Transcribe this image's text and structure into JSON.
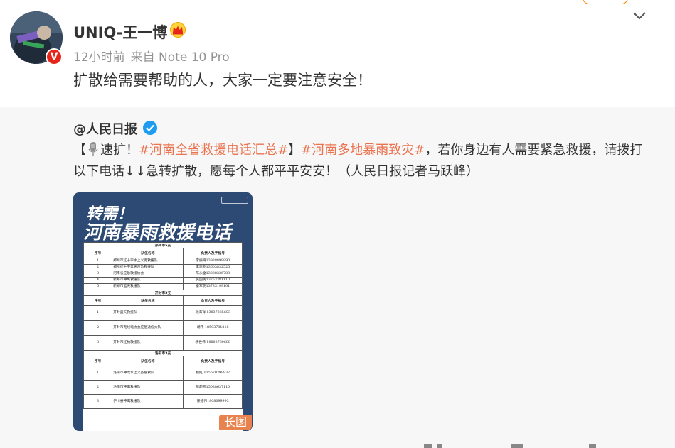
{
  "post": {
    "username": "UNIQ-王一博",
    "time": "12小时前",
    "source": "来自 Note 10 Pro",
    "text": "扩散给需要帮助的人，大家一定要注意安全！",
    "avatar_badge": "V"
  },
  "repost": {
    "author": "@人民日报",
    "line1_prefix": "【",
    "line1_speed": "速扩！",
    "tag1": "#河南全省救援电话汇总#",
    "line1_mid": "】",
    "tag2": "#河南多地暴雨致灾#",
    "line1_suffix": "，若你身边有人需要紧急救援，请拨打",
    "line2": "以下电话↓↓急转扩散，愿每个人都平平安安！（人民日报记者马跃峰）",
    "image": {
      "heading1": "转需！",
      "heading2": "河南暴雨救援电话",
      "long_badge": "长图",
      "sections": [
        {
          "title": "郑州市5支",
          "headers": [
            "序号",
            "队伍名称",
            "负责人及手机号"
          ],
          "rows": [
            [
              "1",
              "郑州市红十字水上义务救援队",
              "李振海13938898890"
            ],
            [
              "2",
              "郑州红十字蓝天应急救援队",
              "李志刚13603832525"
            ],
            [
              "3",
              "河南省应急救援协会",
              "陈永全13838336788"
            ],
            [
              "4",
              "新郑市神鹰救援队",
              "吴国民13253381110"
            ],
            [
              "5",
              "新郑市蓝天救援队",
              "秦军明13733199101"
            ]
          ]
        },
        {
          "title": "开封市3支",
          "headers": [
            "序号",
            "队伍名称",
            "负责人及手机号"
          ],
          "rows": [
            [
              "1",
              "开封蓝天救援队",
              "张海祥 13837835603"
            ],
            [
              "2",
              "开封市无线电协会应急通信大队",
              "靖伟 18503781818"
            ],
            [
              "3",
              "开封市红豹救援队",
              "杨世伟 18803789688"
            ]
          ]
        },
        {
          "title": "洛阳市3支",
          "headers": [
            "序号",
            "队伍名称",
            "负责人及手机号"
          ],
          "rows": [
            [
              "1",
              "洛阳市神龙水上义务搜救队",
              "杨红山15670399937"
            ],
            [
              "2",
              "洛阳市神鹰救援队",
              "张超凯15038637110"
            ],
            [
              "3",
              "伊川县神鹰救援队",
              "梁德伟1808099993"
            ]
          ]
        }
      ]
    }
  }
}
